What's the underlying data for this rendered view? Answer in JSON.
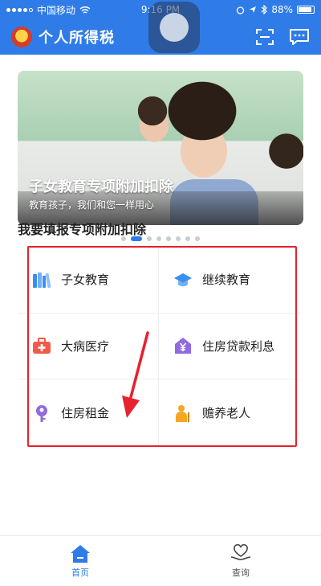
{
  "status_bar": {
    "carrier": "中国移动",
    "time": "9:16 PM",
    "battery": "88%"
  },
  "header": {
    "title": "个人所得税",
    "icons": [
      "scan-icon",
      "message-icon"
    ]
  },
  "banner": {
    "title": "子女教育专项附加扣除",
    "subtitle": "教育孩子，我们和您一样用心",
    "slide_count": 8,
    "active_slide": 2
  },
  "section": {
    "title": "我要填报专项附加扣除"
  },
  "deductions": [
    {
      "label": "子女教育",
      "icon": "books-icon",
      "color": "#3a8ff0"
    },
    {
      "label": "继续教育",
      "icon": "graduation-cap-icon",
      "color": "#3a8ff0"
    },
    {
      "label": "大病医疗",
      "icon": "medical-kit-icon",
      "color": "#f05a4a"
    },
    {
      "label": "住房贷款利息",
      "icon": "yen-house-icon",
      "color": "#8e6be0"
    },
    {
      "label": "住房租金",
      "icon": "key-icon",
      "color": "#8e6be0"
    },
    {
      "label": "赡养老人",
      "icon": "elderly-person-icon",
      "color": "#f5a623"
    }
  ],
  "tabs": [
    {
      "label": "首页",
      "icon": "home-icon",
      "active": true
    },
    {
      "label": "查询",
      "icon": "heart-hand-icon",
      "active": false
    }
  ],
  "colors": {
    "brand": "#2f7ce8",
    "annotation": "#e7212e"
  }
}
